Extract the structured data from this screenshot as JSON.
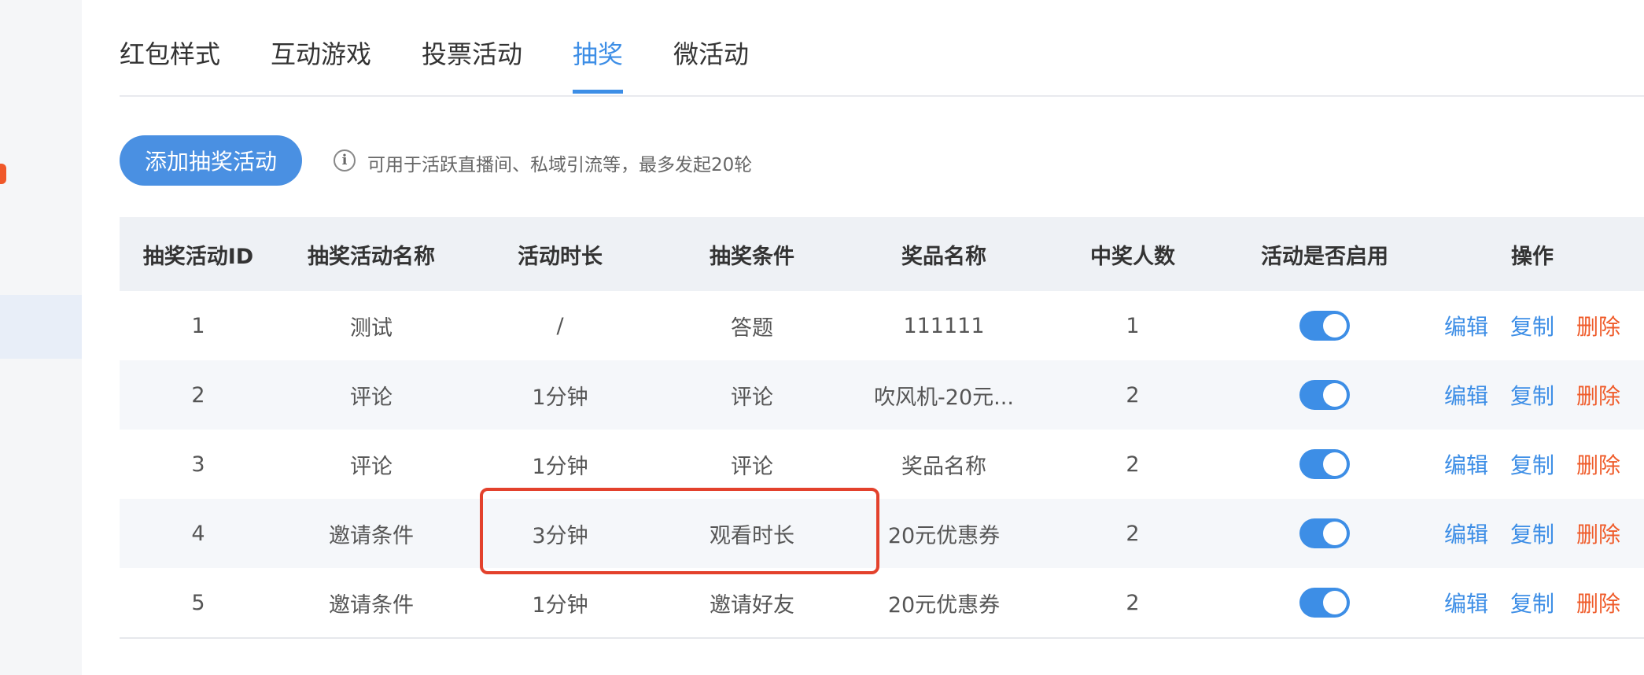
{
  "tabs": [
    {
      "label": "红包样式"
    },
    {
      "label": "互动游戏"
    },
    {
      "label": "投票活动"
    },
    {
      "label": "抽奖"
    },
    {
      "label": "微活动"
    }
  ],
  "active_tab_index": 3,
  "toolbar": {
    "add_label": "添加抽奖活动",
    "info_text": "可用于活跃直播间、私域引流等，最多发起20轮",
    "info_icon": "info-circle-icon"
  },
  "table": {
    "headers": [
      "抽奖活动ID",
      "抽奖活动名称",
      "活动时长",
      "抽奖条件",
      "奖品名称",
      "中奖人数",
      "活动是否启用",
      "操作"
    ],
    "rows": [
      {
        "id": "1",
        "name": "测试",
        "duration": "/",
        "condition": "答题",
        "prize": "111111",
        "winners": "1",
        "enabled": true
      },
      {
        "id": "2",
        "name": "评论",
        "duration": "1分钟",
        "condition": "评论",
        "prize": "吹风机-20元...",
        "winners": "2",
        "enabled": true
      },
      {
        "id": "3",
        "name": "评论",
        "duration": "1分钟",
        "condition": "评论",
        "prize": "奖品名称",
        "winners": "2",
        "enabled": true
      },
      {
        "id": "4",
        "name": "邀请条件",
        "duration": "3分钟",
        "condition": "观看时长",
        "prize": "20元优惠券",
        "winners": "2",
        "enabled": true
      },
      {
        "id": "5",
        "name": "邀请条件",
        "duration": "1分钟",
        "condition": "邀请好友",
        "prize": "20元优惠券",
        "winners": "2",
        "enabled": true
      }
    ],
    "actions": {
      "edit": "编辑",
      "copy": "复制",
      "delete": "删除"
    }
  },
  "colors": {
    "accent": "#3d8ee6",
    "danger": "#ef5b2a",
    "highlight_box": "#e3412c"
  }
}
